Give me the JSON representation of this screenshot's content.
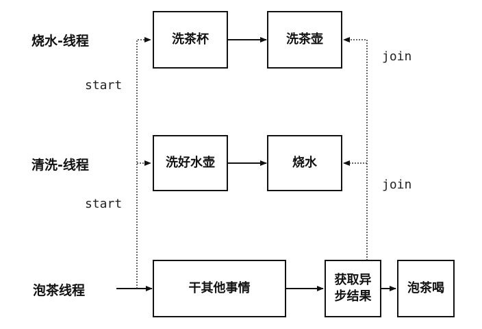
{
  "threads": {
    "boil": "烧水-线程",
    "wash": "清洗-线程",
    "tea": "泡茶线程"
  },
  "annotations": {
    "start_boil": "start",
    "start_wash": "start",
    "join_boil": "join",
    "join_wash": "join"
  },
  "boxes": {
    "wash_cup": "洗茶杯",
    "wash_pot": "洗茶壶",
    "wash_kettle": "洗好水壶",
    "boil_water": "烧水",
    "other_things": "干其他事情",
    "get_async_line1": "获取异",
    "get_async_line2": "步结果",
    "make_tea": "泡茶喝"
  }
}
